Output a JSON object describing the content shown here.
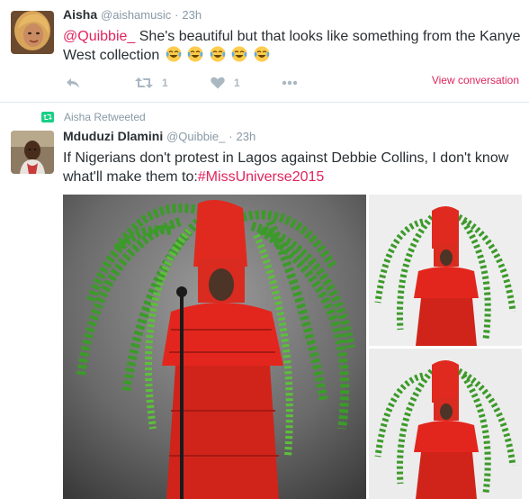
{
  "tweet1": {
    "name": "Aisha",
    "handle": "@aishamusic",
    "separator": "·",
    "time": "23h",
    "mention": "@Quibbie_",
    "text": " She's beautiful but that looks like something from the Kanye West collection",
    "emoji": "face-with-tears-of-joy",
    "retweet_count": "1",
    "like_count": "1",
    "view_conversation": "View conversation"
  },
  "retweet_notice": "Aisha Retweeted",
  "tweet2": {
    "name": "Mduduzi Dlamini",
    "handle": "@Quibbie_",
    "separator": "·",
    "time": "23h",
    "text": "If Nigerians don't protest in Lagos against Debbie Collins, I don't know what'll make them to:",
    "hashtag": "#MissUniverse2015"
  },
  "colors": {
    "accent": "#e0245e",
    "muted": "#8899a6",
    "icon": "#aab8c2",
    "retweet_green": "#19cf86"
  },
  "icons": [
    "reply-icon",
    "retweet-icon",
    "heart-icon",
    "more-icon",
    "retweet-notice-icon"
  ]
}
